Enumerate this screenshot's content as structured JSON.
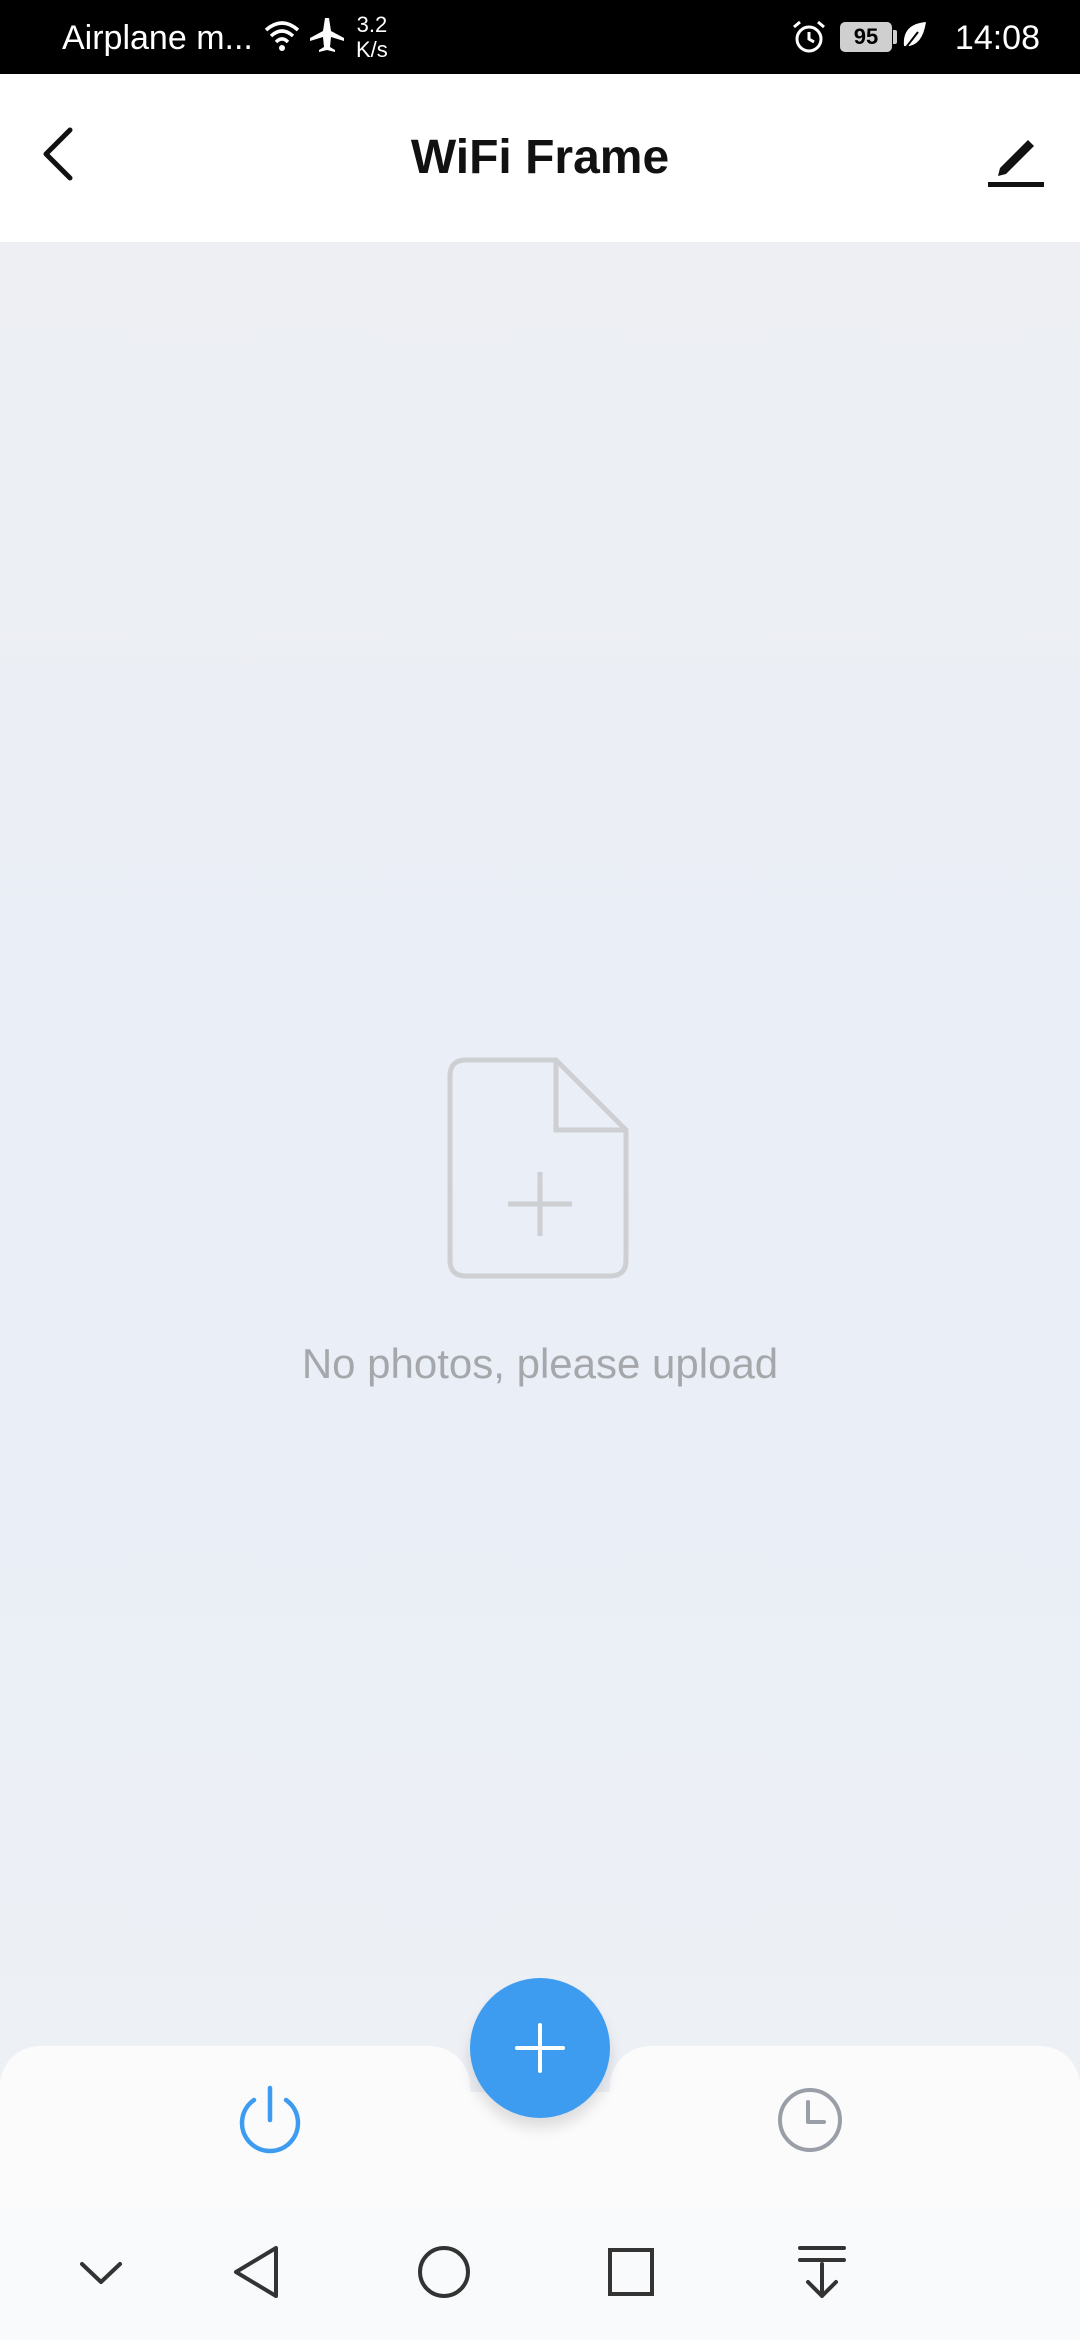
{
  "status_bar": {
    "carrier": "Airplane m...",
    "speed_value": "3.2",
    "speed_unit": "K/s",
    "battery": "95",
    "time": "14:08",
    "icons": [
      "wifi-icon",
      "airplane-icon",
      "alarm-icon",
      "battery-icon",
      "leaf-icon"
    ]
  },
  "header": {
    "title": "WiFi Frame",
    "icons": [
      "back-arrow-icon",
      "edit-pencil-icon"
    ]
  },
  "empty_state": {
    "icon": "add-file-icon",
    "message": "No photos, please upload"
  },
  "bottom_bar": {
    "icons": [
      "power-icon",
      "add-icon",
      "clock-icon"
    ]
  },
  "nav_bar": {
    "icons": [
      "chevron-down-icon",
      "back-triangle-icon",
      "home-circle-icon",
      "recents-square-icon",
      "pull-down-icon"
    ]
  },
  "colors": {
    "accent": "#3d9cf0",
    "header_bg": "#ffffff",
    "content_bg": "#edf0f5",
    "muted_text": "#a5a7ab",
    "icon_gray": "#9a9ea6"
  }
}
